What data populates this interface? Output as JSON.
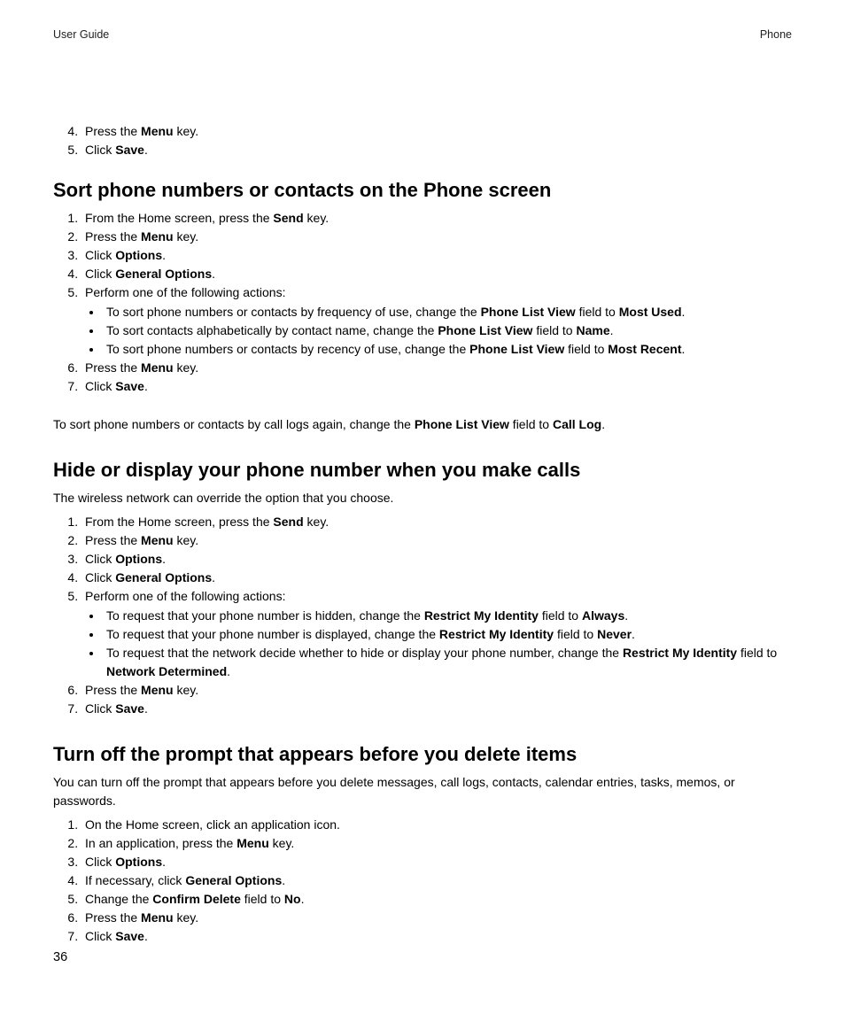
{
  "header": {
    "left": "User Guide",
    "right": "Phone"
  },
  "topList": {
    "start": 4,
    "items": [
      {
        "pre": "Press the ",
        "b": "Menu",
        "post": " key."
      },
      {
        "pre": "Click ",
        "b": "Save",
        "post": "."
      }
    ]
  },
  "section1": {
    "heading": "Sort phone numbers or contacts on the Phone screen",
    "steps": [
      {
        "pre": "From the Home screen, press the ",
        "b": "Send",
        "post": " key."
      },
      {
        "pre": "Press the ",
        "b": "Menu",
        "post": " key."
      },
      {
        "pre": "Click ",
        "b": "Options",
        "post": "."
      },
      {
        "pre": "Click ",
        "b": "General Options",
        "post": "."
      },
      {
        "pre": "Perform one of the following actions:",
        "b": "",
        "post": "",
        "bullets": [
          {
            "pre": "To sort phone numbers or contacts by frequency of use, change the ",
            "b1": "Phone List View",
            "mid": " field to ",
            "b2": "Most Used",
            "post": "."
          },
          {
            "pre": "To sort contacts alphabetically by contact name, change the ",
            "b1": "Phone List View",
            "mid": " field to ",
            "b2": "Name",
            "post": "."
          },
          {
            "pre": "To sort phone numbers or contacts by recency of use, change the ",
            "b1": "Phone List View",
            "mid": " field to ",
            "b2": "Most Recent",
            "post": "."
          }
        ]
      },
      {
        "pre": "Press the ",
        "b": "Menu",
        "post": " key."
      },
      {
        "pre": "Click ",
        "b": "Save",
        "post": "."
      }
    ],
    "trailing": {
      "pre": "To sort phone numbers or contacts by call logs again, change the ",
      "b1": "Phone List View",
      "mid": " field to ",
      "b2": "Call Log",
      "post": "."
    }
  },
  "section2": {
    "heading": "Hide or display your phone number when you make calls",
    "intro": "The wireless network can override the option that you choose.",
    "steps": [
      {
        "pre": "From the Home screen, press the ",
        "b": "Send",
        "post": " key."
      },
      {
        "pre": "Press the ",
        "b": "Menu",
        "post": " key."
      },
      {
        "pre": "Click ",
        "b": "Options",
        "post": "."
      },
      {
        "pre": "Click ",
        "b": "General Options",
        "post": "."
      },
      {
        "pre": "Perform one of the following actions:",
        "b": "",
        "post": "",
        "bullets": [
          {
            "pre": "To request that your phone number is hidden, change the ",
            "b1": "Restrict My Identity",
            "mid": " field to ",
            "b2": "Always",
            "post": "."
          },
          {
            "pre": "To request that your phone number is displayed, change the ",
            "b1": "Restrict My Identity",
            "mid": " field to ",
            "b2": "Never",
            "post": "."
          },
          {
            "pre": "To request that the network decide whether to hide or display your phone number, change the ",
            "b1": "Restrict My Identity",
            "mid": " field to ",
            "b2": "Network Determined",
            "post": "."
          }
        ]
      },
      {
        "pre": "Press the ",
        "b": "Menu",
        "post": " key."
      },
      {
        "pre": "Click ",
        "b": "Save",
        "post": "."
      }
    ]
  },
  "section3": {
    "heading": "Turn off the prompt that appears before you delete items",
    "intro": "You can turn off the prompt that appears before you delete messages, call logs, contacts, calendar entries, tasks, memos, or passwords.",
    "steps": [
      {
        "pre": "On the Home screen, click an application icon.",
        "b": "",
        "post": ""
      },
      {
        "pre": "In an application, press the ",
        "b": "Menu",
        "post": " key."
      },
      {
        "pre": "Click ",
        "b": "Options",
        "post": "."
      },
      {
        "pre": "If necessary, click ",
        "b": "General Options",
        "post": "."
      },
      {
        "pre": "Change the ",
        "b1": "Confirm Delete",
        "mid": " field to ",
        "b2": "No",
        "post": ".",
        "two": true
      },
      {
        "pre": "Press the ",
        "b": "Menu",
        "post": " key."
      },
      {
        "pre": "Click ",
        "b": "Save",
        "post": "."
      }
    ]
  },
  "pageNumber": "36"
}
